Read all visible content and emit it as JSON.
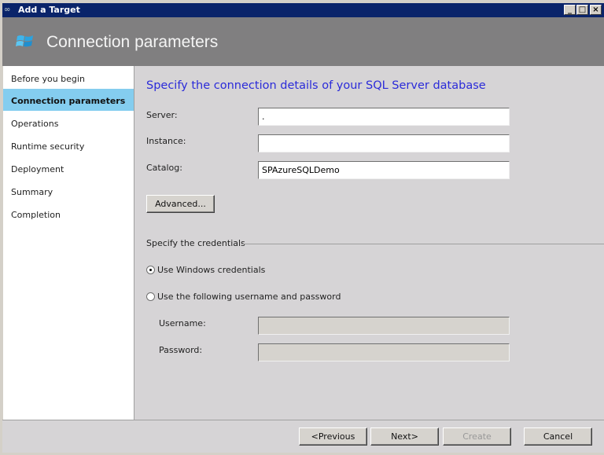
{
  "window": {
    "title": "Add a Target",
    "minimize": "_",
    "maximize": "□",
    "close": "×"
  },
  "header": {
    "title": "Connection parameters",
    "icon": "windows-logo-icon"
  },
  "sidebar": {
    "items": [
      {
        "label": "Before you begin",
        "selected": false
      },
      {
        "label": "Connection parameters",
        "selected": true
      },
      {
        "label": "Operations",
        "selected": false
      },
      {
        "label": "Runtime security",
        "selected": false
      },
      {
        "label": "Deployment",
        "selected": false
      },
      {
        "label": "Summary",
        "selected": false
      },
      {
        "label": "Completion",
        "selected": false
      }
    ]
  },
  "main": {
    "heading": "Specify the connection details of your SQL Server database",
    "server_label": "Server:",
    "server_value": ".",
    "instance_label": "Instance:",
    "instance_value": "",
    "catalog_label": "Catalog:",
    "catalog_value": "SPAzureSQLDemo",
    "advanced_label": "Advanced...",
    "credentials_title": "Specify the credentials",
    "radio_windows": "Use Windows credentials",
    "radio_userpass": "Use the following username and password",
    "selected_credential": "windows",
    "username_label": "Username:",
    "username_value": "",
    "password_label": "Password:",
    "password_value": ""
  },
  "footer": {
    "previous": "<Previous",
    "next": "Next>",
    "create": "Create",
    "cancel": "Cancel"
  },
  "colors": {
    "titlebar": "#0a246a",
    "header": "#807f80",
    "selected": "#84cdef",
    "heading": "#2b2bd9"
  }
}
